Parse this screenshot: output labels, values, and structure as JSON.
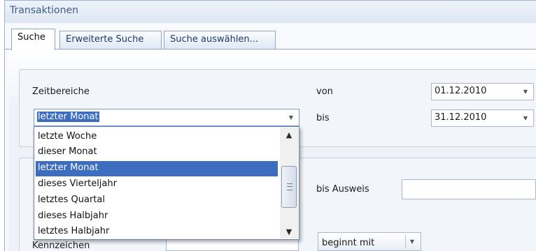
{
  "window": {
    "title": "Transaktionen"
  },
  "tabs": [
    {
      "label": "Suche",
      "active": true
    },
    {
      "label": "Erweiterte Suche",
      "active": false
    },
    {
      "label": "Suche auswählen...",
      "active": false
    }
  ],
  "zeitbereiche": {
    "label": "Zeitbereiche",
    "selected_value": "letzter Monat",
    "options": [
      "letzte Woche",
      "dieser Monat",
      "letzter Monat",
      "dieses Vierteljahr",
      "letztes Quartal",
      "dieses Halbjahr",
      "letztes Halbjahr"
    ],
    "highlighted_index": 2
  },
  "date_range": {
    "from_label": "von",
    "from_value": "01.12.2010",
    "to_label": "bis",
    "to_value": "31.12.2010"
  },
  "ausweis": {
    "to_label": "bis Ausweis",
    "to_value": ""
  },
  "kennzeichen": {
    "label": "Kennzeichen",
    "match_mode": "beginnt mit"
  },
  "colors": {
    "accent": "#3c6dbf",
    "border": "#8fa6c6",
    "title_text": "#3f5d85"
  }
}
